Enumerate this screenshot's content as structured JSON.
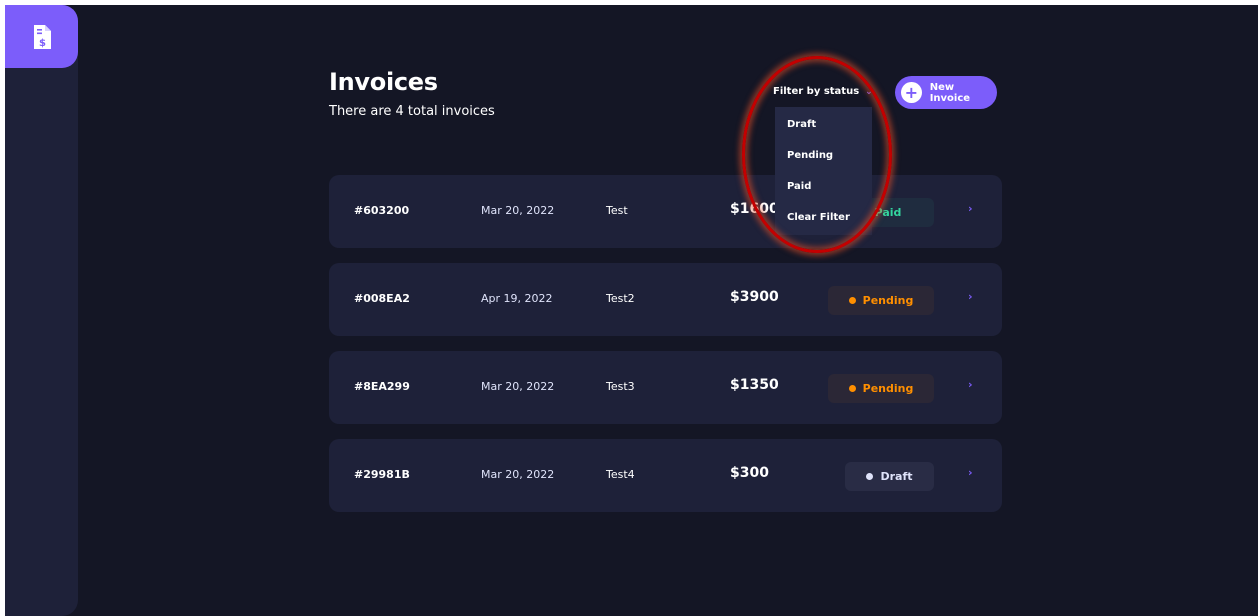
{
  "header": {
    "title": "Invoices",
    "subtitle": "There are 4 total invoices",
    "filter_label": "Filter by status",
    "new_invoice_label": "New Invoice"
  },
  "filter_menu": {
    "options": [
      "Draft",
      "Pending",
      "Paid",
      "Clear Filter"
    ]
  },
  "invoices": [
    {
      "id": "#603200",
      "date": "Mar 20, 2022",
      "client": "Test",
      "amount": "$1600",
      "status": "Paid"
    },
    {
      "id": "#008EA2",
      "date": "Apr 19, 2022",
      "client": "Test2",
      "amount": "$3900",
      "status": "Pending"
    },
    {
      "id": "#8EA299",
      "date": "Mar 20, 2022",
      "client": "Test3",
      "amount": "$1350",
      "status": "Pending"
    },
    {
      "id": "#29981B",
      "date": "Mar 20, 2022",
      "client": "Test4",
      "amount": "$300",
      "status": "Draft"
    }
  ],
  "icons": {
    "logo": "invoice-dollar-icon",
    "filter": "chevron-down-icon",
    "new_invoice": "plus-icon",
    "row_arrow": "chevron-right-icon"
  },
  "colors": {
    "background": "#141625",
    "sidebar": "#1e2139",
    "card": "#1e2139",
    "accent": "#7c5dfa",
    "paid": "#33d69f",
    "pending": "#ff8f00",
    "draft": "#dfe3fa",
    "highlight": "#c40000"
  }
}
